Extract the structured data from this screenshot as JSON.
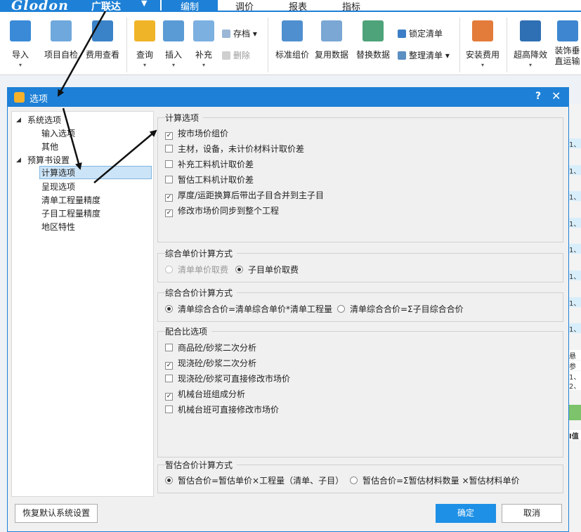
{
  "app": {
    "brand": "Glodon",
    "brand_cn": "广联达",
    "brand_caret": "▼",
    "nav_tabs": [
      "编制",
      "调价",
      "报表",
      "指标"
    ]
  },
  "ribbon": {
    "buttons": [
      "导入",
      "项目自检",
      "费用查看",
      "查询",
      "插入",
      "补充",
      "标准组价",
      "复用数据",
      "替换数据",
      "安装费用",
      "超高降效",
      "装饰垂直运输"
    ],
    "small": {
      "save": "存档",
      "delete": "删除",
      "lock_list": "锁定清单",
      "organize_list": "整理清单"
    },
    "dropdown_glyph": "▾"
  },
  "underlay": {
    "cells": [
      "1、",
      "1、",
      "1、",
      "1、",
      "1、",
      "1、",
      "1、",
      "1、",
      "悬",
      "参",
      "1、",
      "2、",
      "I值"
    ]
  },
  "dialog": {
    "title": "选项",
    "help": "?",
    "close": "✕",
    "tree": {
      "caret": "◢",
      "items": [
        {
          "label": "系统选项"
        },
        {
          "label": "输入选项"
        },
        {
          "label": "其他"
        },
        {
          "label": "预算书设置"
        },
        {
          "label": "计算选项"
        },
        {
          "label": "呈现选项"
        },
        {
          "label": "清单工程量精度"
        },
        {
          "label": "子目工程量精度"
        },
        {
          "label": "地区特性"
        }
      ]
    },
    "groups": {
      "calc": {
        "title": "计算选项",
        "options": [
          {
            "label": "按市场价组价",
            "checked": true
          },
          {
            "label": "主材，设备，未计价材料计取价差",
            "checked": false
          },
          {
            "label": "补充工料机计取价差",
            "checked": false
          },
          {
            "label": "暂估工料机计取价差",
            "checked": false
          },
          {
            "label": "厚度/运距换算后带出子目合并到主子目",
            "checked": true
          },
          {
            "label": "修改市场价同步到整个工程",
            "checked": true
          }
        ]
      },
      "unit_price": {
        "title": "综合单价计算方式",
        "options": [
          {
            "label": "清单单价取费",
            "selected": false,
            "disabled": true
          },
          {
            "label": "子目单价取费",
            "selected": true,
            "disabled": false
          }
        ]
      },
      "total_price": {
        "title": "综合合价计算方式",
        "options": [
          {
            "label": "清单综合合价=清单综合单价*清单工程量",
            "selected": true
          },
          {
            "label": "清单综合合价=Σ子目综合合价",
            "selected": false
          }
        ]
      },
      "mix": {
        "title": "配合比选项",
        "options": [
          {
            "label": "商品砼/砂浆二次分析",
            "checked": false
          },
          {
            "label": "现浇砼/砂浆二次分析",
            "checked": true
          },
          {
            "label": "现浇砼/砂浆可直接修改市场价",
            "checked": false
          },
          {
            "label": "机械台班组成分析",
            "checked": true
          },
          {
            "label": "机械台班可直接修改市场价",
            "checked": false
          }
        ]
      },
      "estimate": {
        "title": "暂估合价计算方式",
        "options": [
          {
            "label": "暂估合价=暂估单价×工程量（清单、子目）",
            "selected": true
          },
          {
            "label": "暂估合价=Σ暂估材料数量 ×暂估材料单价",
            "selected": false
          }
        ]
      }
    },
    "buttons": {
      "restore": "恢复默认系统设置",
      "ok": "确定",
      "cancel": "取消"
    },
    "check_glyph": "✓"
  }
}
